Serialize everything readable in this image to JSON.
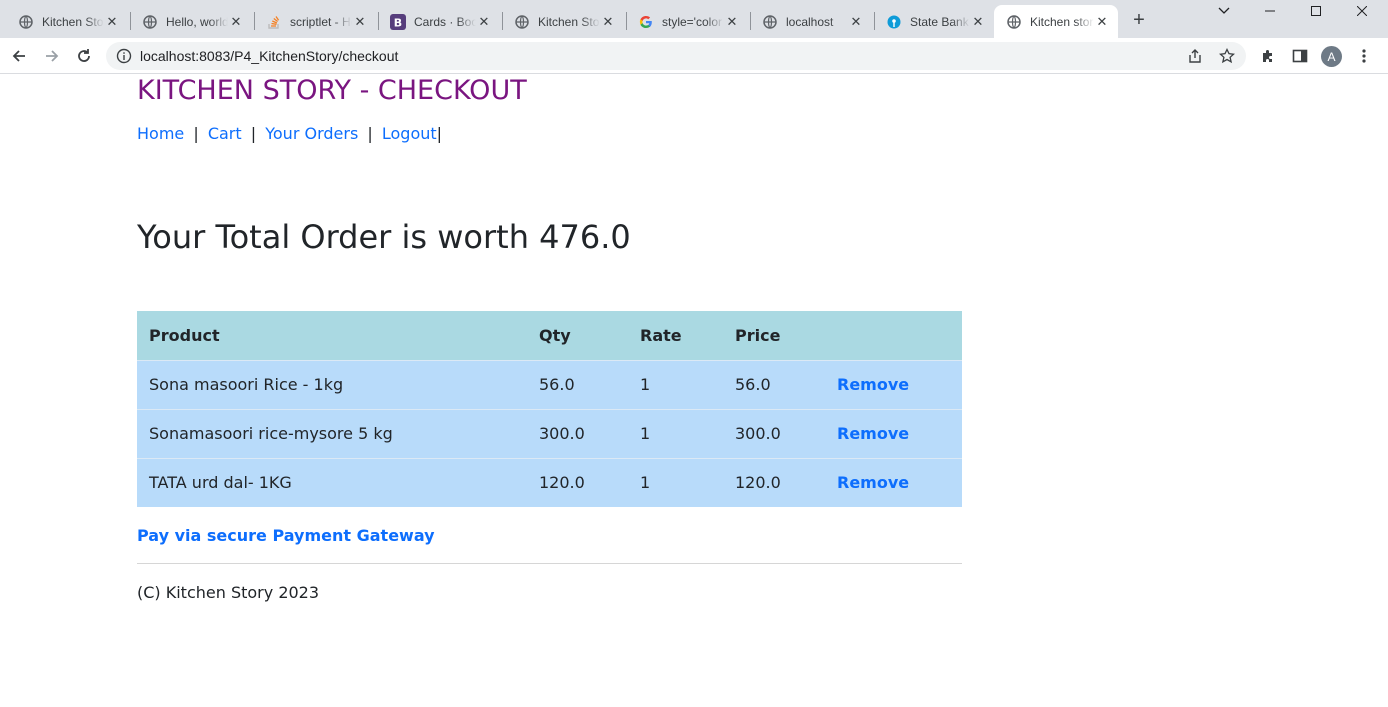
{
  "browser": {
    "tabs": [
      {
        "title": "Kitchen Story",
        "icon": "globe-icon"
      },
      {
        "title": "Hello, world!",
        "icon": "globe-icon"
      },
      {
        "title": "scriptlet - How",
        "icon": "stackoverflow-icon"
      },
      {
        "title": "Cards · Bootstrap",
        "icon": "bootstrap-icon"
      },
      {
        "title": "Kitchen Story",
        "icon": "globe-icon"
      },
      {
        "title": "style='color",
        "icon": "google-icon"
      },
      {
        "title": "localhost",
        "icon": "globe-icon"
      },
      {
        "title": "State Bank",
        "icon": "sbi-icon"
      },
      {
        "title": "Kitchen story",
        "icon": "globe-icon",
        "active": true
      }
    ],
    "url": "localhost:8083/P4_KitchenStory/checkout",
    "profile_initial": "A"
  },
  "site": {
    "title": "KITCHEN STORY - CHECKOUT",
    "nav": {
      "home": "Home",
      "cart": "Cart",
      "orders": "Your Orders",
      "logout": "Logout",
      "separator": "|"
    },
    "total_heading": "Your Total Order is worth 476.0"
  },
  "cart": {
    "headers": {
      "product": "Product",
      "qty": "Qty",
      "rate": "Rate",
      "price": "Price"
    },
    "rows": [
      {
        "product": "Sona masoori Rice - 1kg",
        "qty": "56.0",
        "rate": "1",
        "price": "56.0",
        "action": "Remove"
      },
      {
        "product": "Sonamasoori rice-mysore 5 kg",
        "qty": "300.0",
        "rate": "1",
        "price": "300.0",
        "action": "Remove"
      },
      {
        "product": "TATA urd dal- 1KG",
        "qty": "120.0",
        "rate": "1",
        "price": "120.0",
        "action": "Remove"
      }
    ]
  },
  "pay_link": "Pay via secure Payment Gateway",
  "footer": "(C) Kitchen Story 2023",
  "colors": {
    "title": "#7a1580",
    "link": "#0d6efd",
    "table_header": "#aad9e2",
    "table_row": "#b8dbfa"
  }
}
